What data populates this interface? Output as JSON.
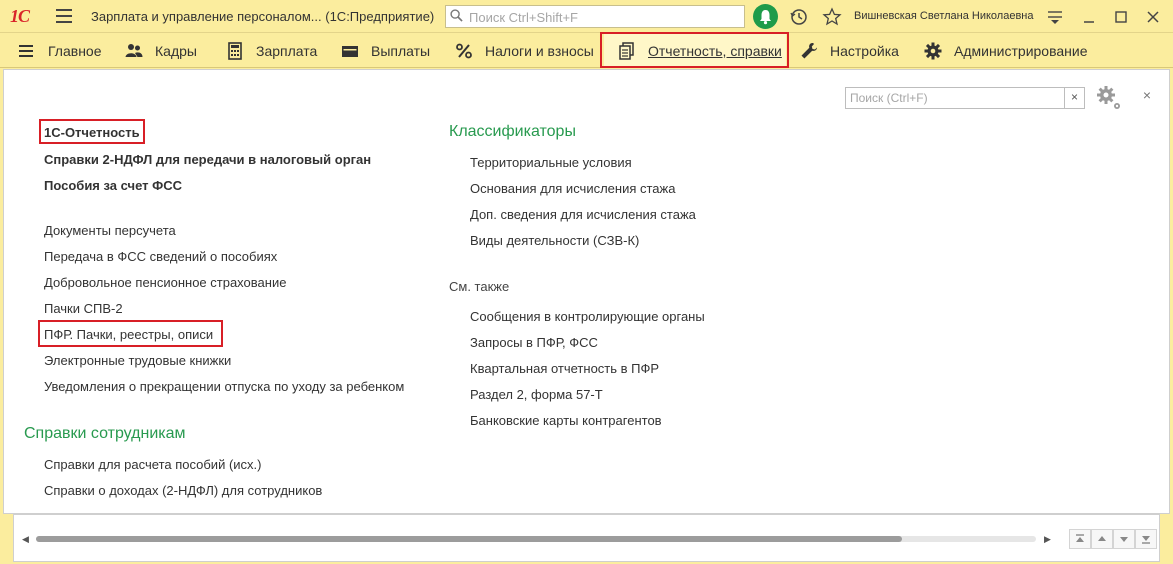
{
  "titlebar": {
    "logo_text": "1С",
    "title": "Зарплата и управление персоналом... (1С:Предприятие)",
    "search_placeholder": "Поиск Ctrl+Shift+F",
    "user": "Вишневская Светлана Николаевна"
  },
  "sections": [
    {
      "label": "Главное",
      "icon": "menu-lines-icon"
    },
    {
      "label": "Кадры",
      "icon": "people-icon"
    },
    {
      "label": "Зарплата",
      "icon": "calculator-icon"
    },
    {
      "label": "Выплаты",
      "icon": "wallet-icon"
    },
    {
      "label": "Налоги и взносы",
      "icon": "percent-icon"
    },
    {
      "label": "Отчетность, справки",
      "icon": "documents-icon",
      "active": true
    },
    {
      "label": "Настройка",
      "icon": "wrench-icon"
    },
    {
      "label": "Администрирование",
      "icon": "gear-icon"
    }
  ],
  "panel": {
    "search_placeholder": "Поиск (Ctrl+F)",
    "clear_label": "×",
    "close_label": "×",
    "left_bold": [
      "1С-Отчетность",
      "Справки 2-НДФЛ для передачи в налоговый орган",
      "Пособия за счет ФСС"
    ],
    "left_links": [
      "Документы персучета",
      "Передача в ФСС сведений о пособиях",
      "Добровольное пенсионное страхование",
      "Пачки СПВ-2",
      "ПФР. Пачки, реестры, описи",
      "Электронные трудовые книжки",
      "Уведомления о прекращении отпуска по уходу за ребенком"
    ],
    "employee_refs": {
      "header": "Справки сотрудникам",
      "items": [
        "Справки для расчета пособий (исх.)",
        "Справки о доходах (2-НДФЛ) для сотрудников"
      ]
    },
    "classifiers": {
      "header": "Классификаторы",
      "items": [
        "Территориальные условия",
        "Основания для исчисления стажа",
        "Доп. сведения для исчисления стажа",
        "Виды деятельности (СЗВ-К)"
      ]
    },
    "see_also": {
      "header": "См. также",
      "items": [
        "Сообщения в контролирующие органы",
        "Запросы в ПФР, ФСС",
        "Квартальная отчетность в ПФР",
        "Раздел 2, форма 57-Т",
        "Банковские карты контрагентов"
      ]
    }
  },
  "colors": {
    "accent_yellow": "#fbed9e",
    "header_green": "#289a4f",
    "highlight_red": "#d81f26",
    "bell_green": "#1f9b4a",
    "logo_red": "#d9242a"
  }
}
